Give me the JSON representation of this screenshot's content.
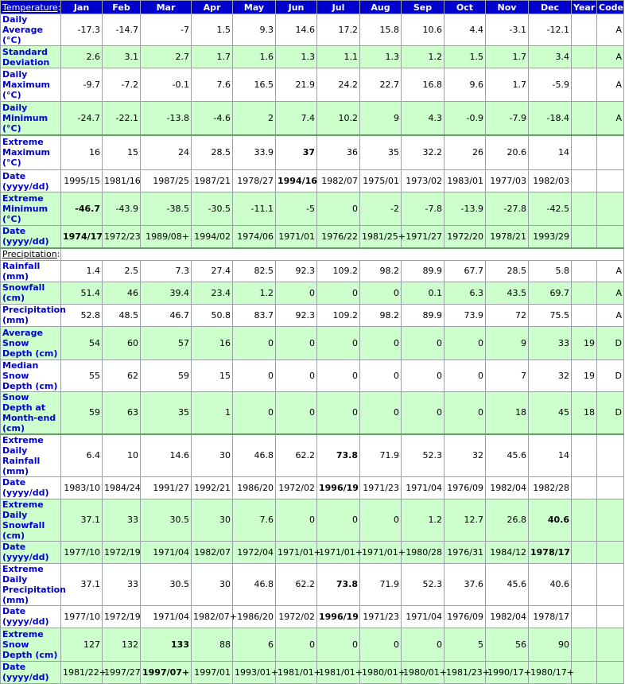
{
  "months": [
    "Jan",
    "Feb",
    "Mar",
    "Apr",
    "May",
    "Jun",
    "Jul",
    "Aug",
    "Sep",
    "Oct",
    "Nov",
    "Dec",
    "Year",
    "Code"
  ],
  "temperature_header": "Temperature",
  "precipitation_header": "Precipitation",
  "temperature": [
    {
      "label": "Daily Average (°C)",
      "h": 30,
      "bg": "w",
      "values": [
        "-17.3",
        "-14.7",
        "-7",
        "1.5",
        "9.3",
        "14.6",
        "17.2",
        "15.8",
        "10.6",
        "4.4",
        "-3.1",
        "-12.1",
        "",
        "A"
      ],
      "bold": []
    },
    {
      "label": "Standard Deviation",
      "h": 28,
      "bg": "g",
      "values": [
        "2.6",
        "3.1",
        "2.7",
        "1.7",
        "1.6",
        "1.3",
        "1.1",
        "1.3",
        "1.2",
        "1.5",
        "1.7",
        "3.4",
        "",
        "A"
      ],
      "bold": []
    },
    {
      "label": "Daily Maximum (°C)",
      "h": 42,
      "bg": "w",
      "values": [
        "-9.7",
        "-7.2",
        "-0.1",
        "7.6",
        "16.5",
        "21.9",
        "24.2",
        "22.7",
        "16.8",
        "9.6",
        "1.7",
        "-5.9",
        "",
        "A"
      ],
      "bold": []
    },
    {
      "label": "Daily Minimum (°C)",
      "h": 42,
      "bg": "g",
      "values": [
        "-24.7",
        "-22.1",
        "-13.8",
        "-4.6",
        "2",
        "7.4",
        "10.2",
        "9",
        "4.3",
        "-0.9",
        "-7.9",
        "-18.4",
        "",
        "A"
      ],
      "bold": []
    },
    {
      "label": "Extreme Maximum (°C)",
      "h": 44,
      "bg": "w",
      "gap": true,
      "values": [
        "16",
        "15",
        "24",
        "28.5",
        "33.9",
        "37",
        "36",
        "35",
        "32.2",
        "26",
        "20.6",
        "14",
        "",
        ""
      ],
      "bold": [
        5
      ]
    },
    {
      "label": "Date (yyyy/dd)",
      "h": 28,
      "bg": "w",
      "values": [
        "1995/15",
        "1981/16",
        "1987/25",
        "1987/21",
        "1978/27",
        "1994/16",
        "1982/07",
        "1975/01",
        "1973/02",
        "1983/01",
        "1977/03",
        "1982/03",
        "",
        ""
      ],
      "bold": [
        5
      ]
    },
    {
      "label": "Extreme Minimum (°C)",
      "h": 42,
      "bg": "g",
      "values": [
        "-46.7",
        "-43.9",
        "-38.5",
        "-30.5",
        "-11.1",
        "-5",
        "0",
        "-2",
        "-7.8",
        "-13.9",
        "-27.8",
        "-42.5",
        "",
        ""
      ],
      "bold": [
        0
      ]
    },
    {
      "label": "Date (yyyy/dd)",
      "h": 28,
      "bg": "g",
      "values": [
        "1974/17",
        "1972/23",
        "1989/08+",
        "1994/02",
        "1974/06",
        "1971/01",
        "1976/22",
        "1981/25+",
        "1971/27",
        "1972/20",
        "1978/21",
        "1993/29",
        "",
        ""
      ],
      "bold": [
        0
      ]
    }
  ],
  "precipitation": [
    {
      "label": "Rainfall (mm)",
      "h": 16,
      "bg": "w",
      "values": [
        "1.4",
        "2.5",
        "7.3",
        "27.4",
        "82.5",
        "92.3",
        "109.2",
        "98.2",
        "89.9",
        "67.7",
        "28.5",
        "5.8",
        "",
        "A"
      ],
      "bold": []
    },
    {
      "label": "Snowfall (cm)",
      "h": 28,
      "bg": "g",
      "values": [
        "51.4",
        "46",
        "39.4",
        "23.4",
        "1.2",
        "0",
        "0",
        "0",
        "0.1",
        "6.3",
        "43.5",
        "69.7",
        "",
        "A"
      ],
      "bold": []
    },
    {
      "label": "Precipitation (mm)",
      "h": 28,
      "bg": "w",
      "values": [
        "52.8",
        "48.5",
        "46.7",
        "50.8",
        "83.7",
        "92.3",
        "109.2",
        "98.2",
        "89.9",
        "73.9",
        "72",
        "75.5",
        "",
        "A"
      ],
      "bold": []
    },
    {
      "label": "Average Snow Depth (cm)",
      "h": 42,
      "bg": "g",
      "values": [
        "54",
        "60",
        "57",
        "16",
        "0",
        "0",
        "0",
        "0",
        "0",
        "0",
        "9",
        "33",
        "19",
        "D"
      ],
      "bold": []
    },
    {
      "label": "Median Snow Depth (cm)",
      "h": 28,
      "bg": "w",
      "values": [
        "55",
        "62",
        "59",
        "15",
        "0",
        "0",
        "0",
        "0",
        "0",
        "0",
        "7",
        "32",
        "19",
        "D"
      ],
      "bold": []
    },
    {
      "label": "Snow Depth at Month-end (cm)",
      "h": 42,
      "bg": "g",
      "values": [
        "59",
        "63",
        "35",
        "1",
        "0",
        "0",
        "0",
        "0",
        "0",
        "0",
        "18",
        "45",
        "18",
        "D"
      ],
      "bold": []
    },
    {
      "label": "Extreme Daily Rainfall (mm)",
      "h": 28,
      "bg": "w",
      "gap": true,
      "values": [
        "6.4",
        "10",
        "14.6",
        "30",
        "46.8",
        "62.2",
        "73.8",
        "71.9",
        "52.3",
        "32",
        "45.6",
        "14",
        "",
        ""
      ],
      "bold": [
        6
      ]
    },
    {
      "label": "Date (yyyy/dd)",
      "h": 28,
      "bg": "w",
      "values": [
        "1983/10",
        "1984/24",
        "1991/27",
        "1992/21",
        "1986/20",
        "1972/02",
        "1996/19",
        "1971/23",
        "1971/04",
        "1976/09",
        "1982/04",
        "1982/28",
        "",
        ""
      ],
      "bold": [
        6
      ]
    },
    {
      "label": "Extreme Daily Snowfall (cm)",
      "h": 42,
      "bg": "g",
      "values": [
        "37.1",
        "33",
        "30.5",
        "30",
        "7.6",
        "0",
        "0",
        "0",
        "1.2",
        "12.7",
        "26.8",
        "40.6",
        "",
        ""
      ],
      "bold": [
        11
      ]
    },
    {
      "label": "Date (yyyy/dd)",
      "h": 28,
      "bg": "g",
      "values": [
        "1977/10",
        "1972/19",
        "1971/04",
        "1982/07",
        "1972/04",
        "1971/01+",
        "1971/01+",
        "1971/01+",
        "1980/28",
        "1976/31",
        "1984/12",
        "1978/17",
        "",
        ""
      ],
      "bold": [
        11
      ]
    },
    {
      "label": "Extreme Daily Precipitation (mm)",
      "h": 42,
      "bg": "w",
      "values": [
        "37.1",
        "33",
        "30.5",
        "30",
        "46.8",
        "62.2",
        "73.8",
        "71.9",
        "52.3",
        "37.6",
        "45.6",
        "40.6",
        "",
        ""
      ],
      "bold": [
        6
      ]
    },
    {
      "label": "Date (yyyy/dd)",
      "h": 28,
      "bg": "w",
      "values": [
        "1977/10",
        "1972/19",
        "1971/04",
        "1982/07+",
        "1986/20",
        "1972/02",
        "1996/19",
        "1971/23",
        "1971/04",
        "1976/09",
        "1982/04",
        "1978/17",
        "",
        ""
      ],
      "bold": [
        6
      ]
    },
    {
      "label": "Extreme Snow Depth (cm)",
      "h": 42,
      "bg": "g",
      "values": [
        "127",
        "132",
        "133",
        "88",
        "6",
        "0",
        "0",
        "0",
        "0",
        "5",
        "56",
        "90",
        "",
        ""
      ],
      "bold": [
        2
      ]
    },
    {
      "label": "Date (yyyy/dd)",
      "h": 28,
      "bg": "g",
      "values": [
        "1981/22+",
        "1997/27",
        "1997/07+",
        "1997/01",
        "1993/01+",
        "1981/01+",
        "1981/01+",
        "1980/01+",
        "1980/01+",
        "1981/23+",
        "1990/17+",
        "1980/17+",
        "",
        ""
      ],
      "bold": [
        2
      ]
    }
  ]
}
